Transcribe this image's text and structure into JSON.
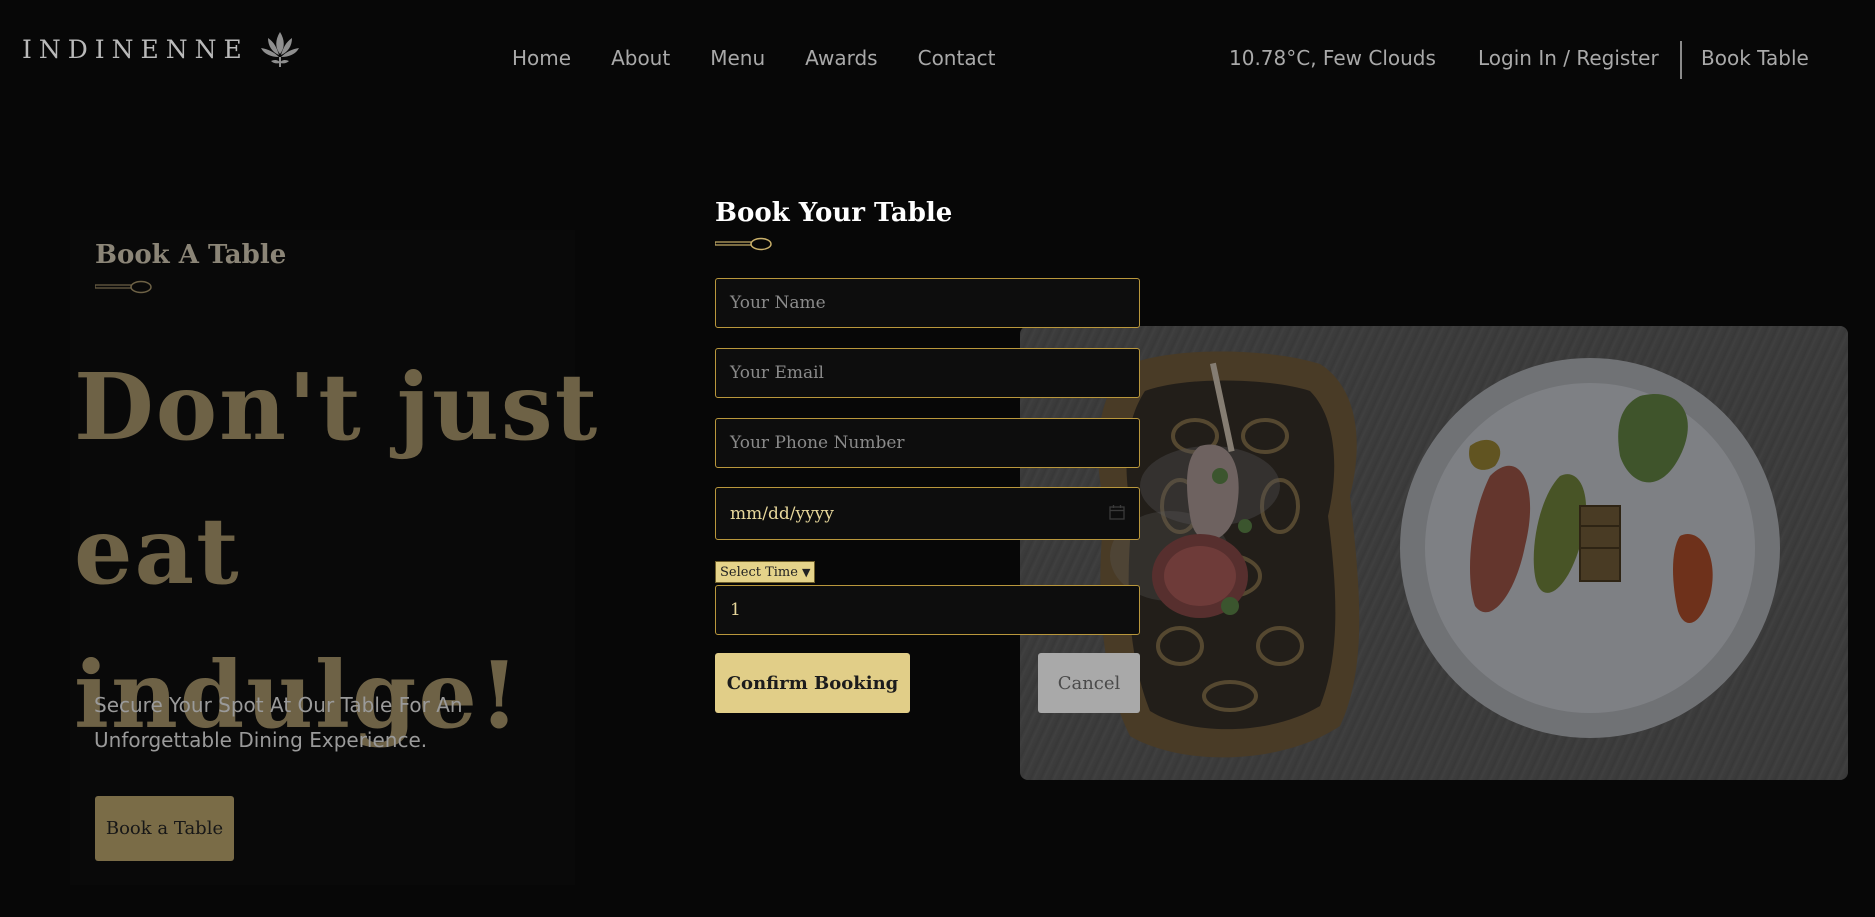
{
  "header": {
    "logo_text": "INDINENNE",
    "logo_icon": "lotus-icon",
    "nav": [
      "Home",
      "About",
      "Menu",
      "Awards",
      "Contact"
    ],
    "weather": "10.78°C, Few Clouds",
    "login": "Login In / Register",
    "book_table": "Book Table"
  },
  "hero": {
    "section_label": "Book A Table",
    "headline_line1": "Don't just eat",
    "headline_line2": "indulge!",
    "subtext": "Secure Your Spot At Our Table For An Unforgettable Dining Experience.",
    "button": "Book a Table"
  },
  "booking_form": {
    "title": "Book Your Table",
    "name_placeholder": "Your Name",
    "email_placeholder": "Your Email",
    "phone_placeholder": "Your Phone Number",
    "date_value": "mm/dd/yyyy",
    "time_selected": "Select Time",
    "guests_value": "1",
    "confirm": "Confirm Booking",
    "cancel": "Cancel"
  },
  "colors": {
    "background": "#070707",
    "accent_gold": "#e1ce88",
    "field_border": "#b9973c",
    "dimmed_gold": "#6e6246"
  }
}
